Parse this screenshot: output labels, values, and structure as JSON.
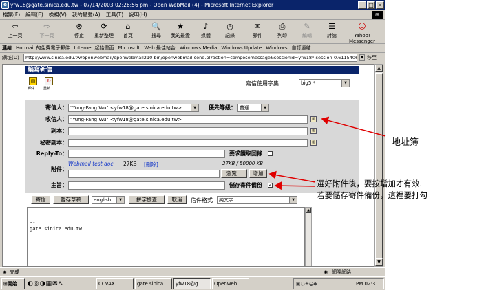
{
  "window": {
    "title": "yfw18@gate.sinica.edu.tw - 07/14/2003 02:26:56 pm - Open WebMail (4) - Microsoft Internet Explorer"
  },
  "menu": [
    "檔案(F)",
    "編輯(E)",
    "檢視(V)",
    "我的最愛(A)",
    "工具(T)",
    "說明(H)"
  ],
  "toolbar": [
    {
      "label": "上一頁",
      "icon": "⇦"
    },
    {
      "label": "下一頁",
      "icon": "⇨"
    },
    {
      "label": "停止",
      "icon": "⊗"
    },
    {
      "label": "重新整理",
      "icon": "⟳"
    },
    {
      "label": "首頁",
      "icon": "⌂"
    },
    {
      "label": "搜尋",
      "icon": "🔍"
    },
    {
      "label": "我的最愛",
      "icon": "★"
    },
    {
      "label": "媒體",
      "icon": "♪"
    },
    {
      "label": "記錄",
      "icon": "◷"
    },
    {
      "label": "郵件",
      "icon": "✉"
    },
    {
      "label": "列印",
      "icon": "⎙"
    },
    {
      "label": "編輯",
      "icon": "✎"
    },
    {
      "label": "討論",
      "icon": "☰"
    },
    {
      "label": "Yahoo! Messenger",
      "icon": "☺"
    }
  ],
  "links": {
    "label": "連結",
    "items": [
      "Hotmail 的免費電子郵件",
      "Internet 起始畫面",
      "Microsoft",
      "Web 最佳站台",
      "Windows Media",
      "Windows Update",
      "Windows",
      "自訂連結"
    ]
  },
  "address": {
    "label": "網址(D)",
    "url": "http://www.sinica.edu.tw/openwebmail/openwebmail210-bin/openwebmail-send.pl?action=composemessage&sessionid=yfw18*-session-0.61154068143372&sort=",
    "go": "移至"
  },
  "compose": {
    "title": "編寫新信",
    "icon_labels": [
      "郵件",
      "重新"
    ],
    "charset_label": "寫信使用字集",
    "charset_value": "big5 *",
    "from_label": "寄信人：",
    "from_value": "\"Yung-Fang Wu\" <yfw18@gate.sinica.edu.tw>",
    "priority_label": "優先等級：",
    "priority_value": "普通",
    "to_label": "收信人：",
    "to_value": "\"Yung-Fang Wu\" <yfw18@gate.sinica.edu.tw>",
    "cc_label": "副本：",
    "bcc_label": "秘密副本：",
    "replyto_label": "Reply-To：",
    "receipt_label": "要求讀取回條",
    "attach_label": "附件：",
    "attach_file": "Webmail test.doc",
    "attach_size": "27KB",
    "attach_delete": "[刪除]",
    "attach_quota": "27KB / 50000 KB",
    "browse_label": "瀏覽...",
    "add_label": "增加",
    "subject_label": "主旨：",
    "savecopy_label": "儲存寄件備份",
    "send_label": "寄信",
    "draft_label": "暫存草稿",
    "lang_value": "english",
    "spell_label": "拼字檢查",
    "cancel_label": "取消",
    "format_label": "信件格式",
    "format_value": "純文字",
    "body_sig": "--",
    "body_domain": "gate.sinica.edu.tw"
  },
  "statusbar": {
    "left": "完成",
    "zone": "網際網路"
  },
  "taskbar": {
    "start": "開始",
    "items": [
      "CCVAX",
      "gate.sinica...",
      "yfw18@g...",
      "Openweb..."
    ],
    "clock": "PM 02:31"
  },
  "annotations": {
    "addressbook": "地址簿",
    "attach_note_1": "選好附件後，要按增加才有效.",
    "attach_note_2": "若要儲存寄件備份，這裡要打勾"
  },
  "colors": {
    "titlebar": "#0a246a",
    "arrow": "#e00000",
    "link": "#1a3cc8"
  }
}
